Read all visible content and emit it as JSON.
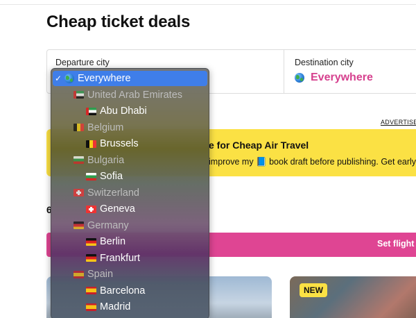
{
  "page": {
    "title": "Cheap ticket deals",
    "results_count_partial": "6"
  },
  "search": {
    "departure_label": "Departure city",
    "destination_label": "Destination city",
    "destination_value": "Everywhere"
  },
  "ad": {
    "label": "ADVERTISEMENT",
    "title": "e for Cheap Air Travel",
    "text": "improve my 📘 book draft before publishing. Get early a"
  },
  "action_bar": {
    "label": "Set flight"
  },
  "cards": {
    "new_badge": "NEW"
  },
  "dropdown": {
    "selected_index": 0,
    "options": [
      {
        "label": "Everywhere",
        "type": "option",
        "selected": true,
        "icon": "globe-icon"
      },
      {
        "label": "United Arab Emirates",
        "type": "group",
        "flag": "ae"
      },
      {
        "label": "Abu Dhabi",
        "type": "option",
        "flag": "ae"
      },
      {
        "label": "Belgium",
        "type": "group",
        "flag": "be"
      },
      {
        "label": "Brussels",
        "type": "option",
        "flag": "be"
      },
      {
        "label": "Bulgaria",
        "type": "group",
        "flag": "bg"
      },
      {
        "label": "Sofia",
        "type": "option",
        "flag": "bg"
      },
      {
        "label": "Switzerland",
        "type": "group",
        "flag": "ch"
      },
      {
        "label": "Geneva",
        "type": "option",
        "flag": "ch"
      },
      {
        "label": "Germany",
        "type": "group",
        "flag": "de"
      },
      {
        "label": "Berlin",
        "type": "option",
        "flag": "de"
      },
      {
        "label": "Frankfurt",
        "type": "option",
        "flag": "de"
      },
      {
        "label": "Spain",
        "type": "group",
        "flag": "es"
      },
      {
        "label": "Barcelona",
        "type": "option",
        "flag": "es"
      },
      {
        "label": "Madrid",
        "type": "option",
        "flag": "es"
      }
    ]
  },
  "colors": {
    "accent_pink": "#df4593",
    "accent_yellow": "#fbe144",
    "selection_blue": "#3f7ee9"
  }
}
